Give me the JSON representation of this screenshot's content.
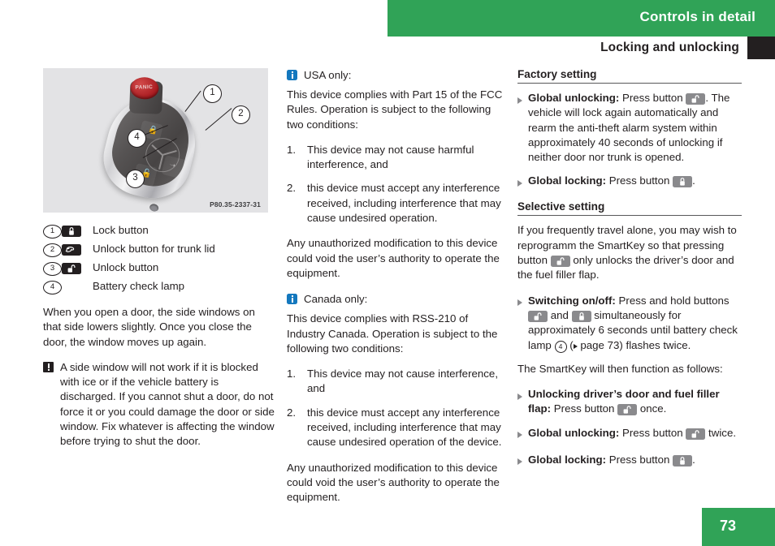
{
  "header": {
    "chapter_title": "Controls in detail",
    "section_title": "Locking and unlocking"
  },
  "figure": {
    "image_code": "P80.35-2337-31",
    "panic_label": "PANIC",
    "callouts": [
      "1",
      "2",
      "3",
      "4"
    ],
    "caption_items": [
      {
        "num": "1",
        "icon": "lock-closed-icon",
        "label": "Lock button"
      },
      {
        "num": "2",
        "icon": "trunk-lid-icon",
        "label": "Unlock button for trunk lid"
      },
      {
        "num": "3",
        "icon": "lock-open-icon",
        "label": "Unlock button"
      },
      {
        "num": "4",
        "icon": "",
        "label": "Battery check lamp"
      }
    ]
  },
  "left_column": {
    "paragraph": "When you open a door, the side windows on that side lowers slightly. Once you close the door, the window moves up again.",
    "warning": "A side window will not work if it is blocked with ice or if the vehicle battery is discharged. If you cannot shut a door, do not force it or you could damage the door or side window. Fix whatever is affecting the window before trying to shut the door."
  },
  "middle_column": {
    "usa_note": {
      "heading": "USA only:",
      "intro": "This device complies with Part 15 of the FCC Rules. Operation is subject to the following two conditions:",
      "conditions": [
        {
          "num": "1.",
          "text": "This device may not cause harmful interference, and"
        },
        {
          "num": "2.",
          "text": "this device must accept any interference received, including interference that may cause undesired operation."
        }
      ],
      "closing": "Any unauthorized modification to this device could void the user’s authority to operate the equipment."
    },
    "canada_note": {
      "heading": "Canada only:",
      "intro": "This device complies with RSS-210 of Industry Canada. Operation is subject to the following two conditions:",
      "conditions": [
        {
          "num": "1.",
          "text": "This device may not cause interference, and"
        },
        {
          "num": "2.",
          "text": "this device must accept any interference received, including interference that may cause undesired operation of the device."
        }
      ],
      "closing": "Any unauthorized modification to this device could void the user’s authority to operate the equipment."
    }
  },
  "right_column": {
    "factory_setting": {
      "heading": "Factory setting",
      "bullets": [
        {
          "bold": "Global unlocking:",
          "text_before_icon": " Press button ",
          "icon": "lock-open-icon",
          "text_after_icon": ". The vehicle will lock again automatically and rearm the anti-theft alarm system within approximately 40 seconds of unlocking if neither door nor trunk is opened."
        },
        {
          "bold": "Global locking:",
          "text_before_icon": " Press button ",
          "icon": "lock-closed-icon",
          "text_after_icon": "."
        }
      ]
    },
    "selective_setting": {
      "heading": "Selective setting",
      "intro_before_icon": "If you frequently travel alone, you may wish to reprogramm the SmartKey so that pressing button ",
      "intro_icon": "lock-open-icon",
      "intro_after_icon": " only unlocks the driver’s door and the fuel filler flap.",
      "switching": {
        "bold": "Switching on/off:",
        "t1": " Press and hold buttons ",
        "icon1": "lock-open-icon",
        "t2": " and ",
        "icon2": "lock-closed-icon",
        "t3": " simultaneously for approximately 6 seconds until battery check lamp ",
        "ref_num": "4",
        "t4": " (",
        "ref_page": " page 73",
        "t5": ") flashes twice."
      },
      "follows_text": "The SmartKey will then function as follows:",
      "bullets": [
        {
          "bold": "Unlocking driver’s door and fuel filler flap:",
          "text_before_icon": " Press button ",
          "icon": "lock-open-icon",
          "text_after_icon": " once."
        },
        {
          "bold": "Global unlocking:",
          "text_before_icon": " Press button ",
          "icon": "lock-open-icon",
          "text_after_icon": " twice."
        },
        {
          "bold": "Global locking:",
          "text_before_icon": " Press button ",
          "icon": "lock-closed-icon",
          "text_after_icon": "."
        }
      ]
    }
  },
  "footer": {
    "page_number": "73"
  },
  "colors": {
    "brand_green": "#30a357",
    "info_blue": "#1478be",
    "icon_gray": "#8a8a8d",
    "icon_dark": "#231f20"
  }
}
